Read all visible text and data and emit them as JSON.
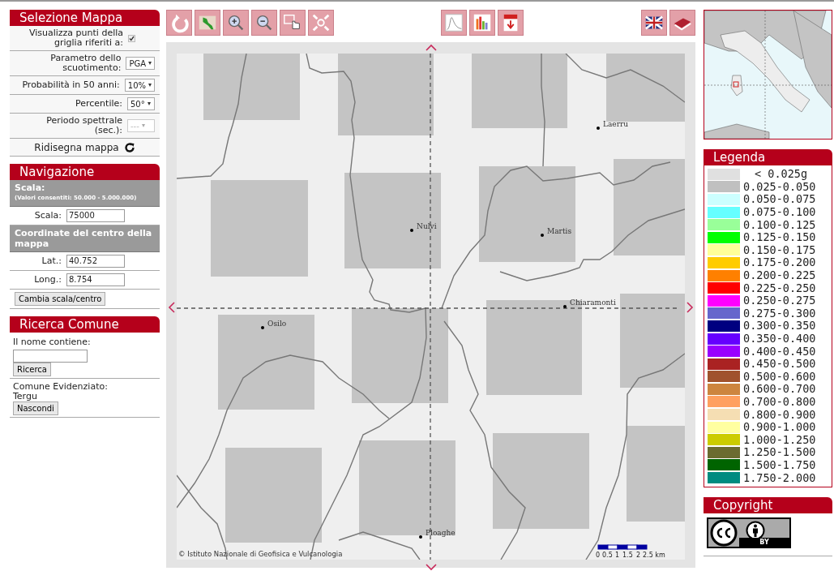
{
  "selezione_mappa": {
    "title": "Selezione Mappa",
    "rows": [
      {
        "kind": "checkbox",
        "label": "Visualizza punti della griglia riferiti a:",
        "checked": true
      },
      {
        "kind": "select",
        "label": "Parametro dello scuotimento:",
        "value": "PGA",
        "disabled": false
      },
      {
        "kind": "select",
        "label": "Probabilità in 50 anni:",
        "value": "10%",
        "disabled": false
      },
      {
        "kind": "select",
        "label": "Percentile:",
        "value": "50°",
        "disabled": false
      },
      {
        "kind": "select",
        "label": "Periodo spettrale (sec.):",
        "value": "---",
        "disabled": true
      },
      {
        "kind": "action",
        "label": "Ridisegna mappa"
      }
    ]
  },
  "navigazione": {
    "title": "Navigazione",
    "blocks": [
      {
        "kind": "heading",
        "text": "Scala:",
        "note": "(Valori consentiti: 50.000 - 5.000.000)"
      },
      {
        "kind": "field",
        "label": "Scala:",
        "value": "75000"
      },
      {
        "kind": "heading",
        "text": "Coordinate del centro della mappa"
      },
      {
        "kind": "field",
        "label": "Lat.:",
        "value": "40.752"
      },
      {
        "kind": "field",
        "label": "Long.:",
        "value": "8.754"
      },
      {
        "kind": "button",
        "label": "Cambia scala/centro"
      }
    ]
  },
  "ricerca_comune": {
    "title": "Ricerca Comune",
    "label": "Il nome contiene:",
    "button": "Ricerca",
    "highlight_label": "Comune Evidenziato:",
    "highlight_value": "Tergu",
    "hide_button": "Nascondi"
  },
  "map": {
    "towns": [
      {
        "name": "Laerru"
      },
      {
        "name": "Nulvi"
      },
      {
        "name": "Martis"
      },
      {
        "name": "Chiaramonti"
      },
      {
        "name": "Osilo"
      },
      {
        "name": "Ploaghe"
      }
    ],
    "attribution": "© Istituto Nazionale di Geofisica e Vulcanologia",
    "scale_labels": [
      "0",
      "0.5",
      "1",
      "1.5",
      "2",
      "2.5 km"
    ]
  },
  "legend": {
    "title": "Legenda",
    "items": [
      {
        "label": "< 0.025g",
        "color": "#e0e0e0"
      },
      {
        "label": "0.025-0.050",
        "color": "#c0c0c0"
      },
      {
        "label": "0.050-0.075",
        "color": "#ccffff"
      },
      {
        "label": "0.075-0.100",
        "color": "#66ffff"
      },
      {
        "label": "0.100-0.125",
        "color": "#99ff99"
      },
      {
        "label": "0.125-0.150",
        "color": "#00ff00"
      },
      {
        "label": "0.150-0.175",
        "color": "#ffff99"
      },
      {
        "label": "0.175-0.200",
        "color": "#ffcc00"
      },
      {
        "label": "0.200-0.225",
        "color": "#ff8000"
      },
      {
        "label": "0.225-0.250",
        "color": "#ff0000"
      },
      {
        "label": "0.250-0.275",
        "color": "#ff00ff"
      },
      {
        "label": "0.275-0.300",
        "color": "#6666cc"
      },
      {
        "label": "0.300-0.350",
        "color": "#000080"
      },
      {
        "label": "0.350-0.400",
        "color": "#6600ff"
      },
      {
        "label": "0.400-0.450",
        "color": "#9900ff"
      },
      {
        "label": "0.450-0.500",
        "color": "#aa2222"
      },
      {
        "label": "0.500-0.600",
        "color": "#a0522d"
      },
      {
        "label": "0.600-0.700",
        "color": "#cd853f"
      },
      {
        "label": "0.700-0.800",
        "color": "#ffa060"
      },
      {
        "label": "0.800-0.900",
        "color": "#f5deb3"
      },
      {
        "label": "0.900-1.000",
        "color": "#ffffa0"
      },
      {
        "label": "1.000-1.250",
        "color": "#cccc00"
      },
      {
        "label": "1.250-1.500",
        "color": "#6b6b30"
      },
      {
        "label": "1.500-1.750",
        "color": "#006400"
      },
      {
        "label": "1.750-2.000",
        "color": "#008b80"
      }
    ]
  },
  "copyright": {
    "title": "Copyright",
    "badge_text": "BY"
  }
}
